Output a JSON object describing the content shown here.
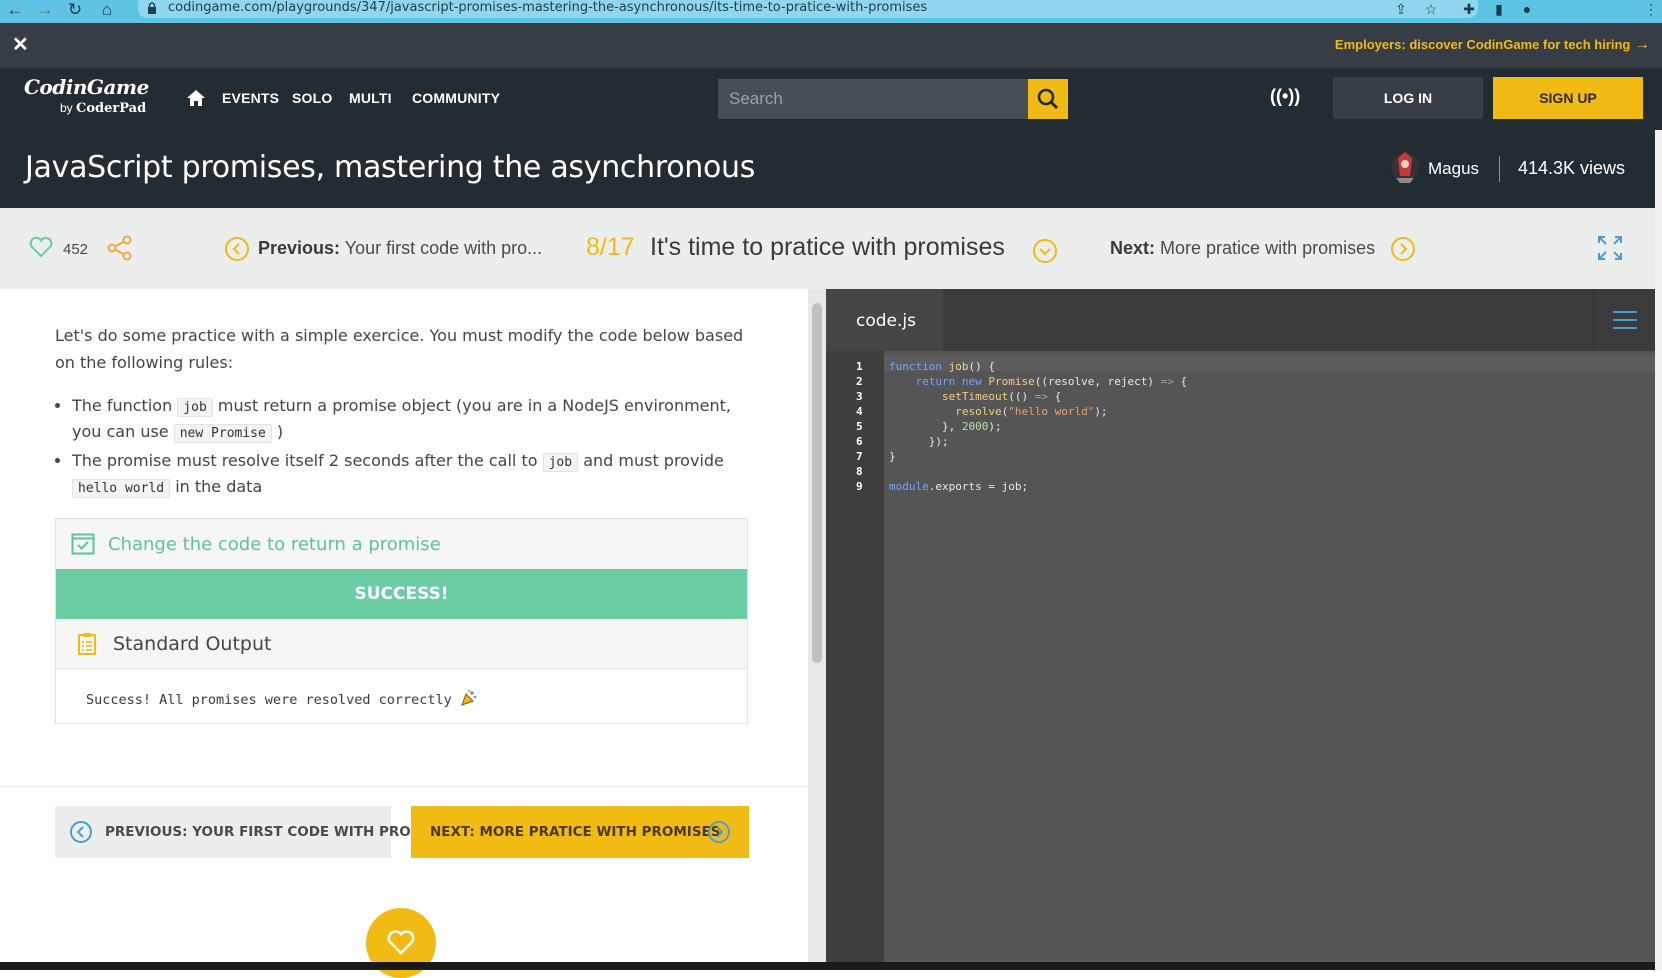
{
  "browser": {
    "url": "codingame.com/playgrounds/347/javascript-promises-mastering-the-asynchronous/its-time-to-pratice-with-promises"
  },
  "employers": {
    "close": "✕",
    "link": "Employers: discover CodinGame for tech hiring"
  },
  "navbar": {
    "logo_main": "CodinGame",
    "logo_by": "by",
    "logo_sub": "CoderPad",
    "links": [
      "EVENTS",
      "SOLO",
      "MULTI",
      "COMMUNITY"
    ],
    "search_placeholder": "Search",
    "login": "LOG IN",
    "signup": "SIGN UP"
  },
  "title_bar": {
    "title": "JavaScript promises, mastering the asynchronous",
    "author": "Magus",
    "views": "414.3K views"
  },
  "lesson_bar": {
    "likes": "452",
    "prev_prefix": "Previous:",
    "prev_title": "Your first code with pro...",
    "chapter_index": "8/17",
    "chapter_title": "It's time to pratice with promises",
    "next_prefix": "Next:",
    "next_title": "More pratice with promises"
  },
  "content": {
    "intro": "Let's do some practice with a simple exercice. You must modify the code below based on the following rules:",
    "rule1_a": "The function",
    "rule1_code1": "job",
    "rule1_b": "must return a promise object (you are in a NodeJS environment, you can use",
    "rule1_code2": "new Promise",
    "rule1_c": ")",
    "rule2_a": "The promise must resolve itself 2 seconds after the call to",
    "rule2_code1": "job",
    "rule2_b": "and must provide",
    "rule2_code2": "hello world",
    "rule2_c": "in the data"
  },
  "test": {
    "name": "Change the code to return a promise",
    "status": "SUCCESS!",
    "stdout_title": "Standard Output",
    "stdout_text": "Success! All promises were resolved correctly"
  },
  "bottom_nav": {
    "prev": "PREVIOUS: YOUR FIRST CODE WITH PRO...",
    "next": "NEXT: MORE PRATICE WITH PROMISES"
  },
  "editor": {
    "filename": "code.js",
    "line_numbers": [
      "1",
      "2",
      "3",
      "4",
      "5",
      "6",
      "7",
      "8",
      "9"
    ]
  },
  "colors": {
    "accent": "#f2bb13",
    "success": "#6ccca4",
    "dark_bg": "#232b33"
  }
}
